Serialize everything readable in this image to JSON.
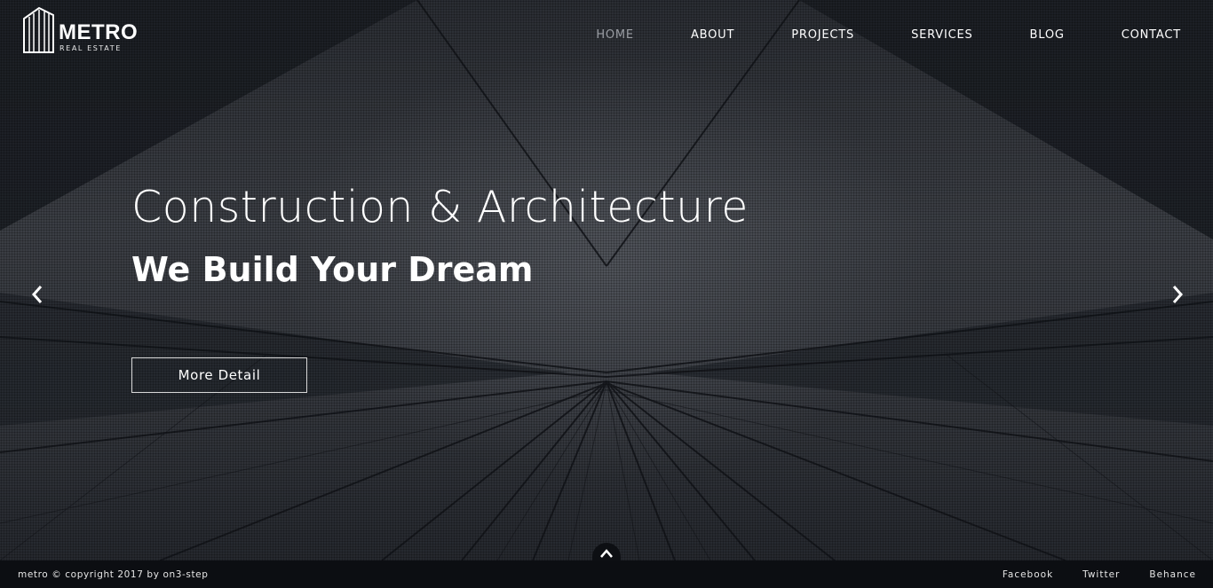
{
  "brand": {
    "name": "METRO",
    "tagline": "REAL ESTATE",
    "logo_icon": "building-icon"
  },
  "nav": {
    "items": [
      {
        "label": "HOME",
        "active": true
      },
      {
        "label": "ABOUT",
        "active": false
      },
      {
        "label": "PROJECTS",
        "active": false
      },
      {
        "label": "SERVICES",
        "active": false
      },
      {
        "label": "BLOG",
        "active": false
      },
      {
        "label": "CONTACT",
        "active": false
      }
    ]
  },
  "hero": {
    "title": "Construction & Architecture",
    "subtitle": "We Build Your Dream",
    "cta_label": "More Detail",
    "prev_icon": "chevron-left-icon",
    "next_icon": "chevron-right-icon",
    "scroll_icon": "chevron-up-icon"
  },
  "footer": {
    "copyright": "metro © copyright 2017 by on3-step",
    "social": [
      "Facebook",
      "Twitter",
      "Behance"
    ]
  },
  "colors": {
    "nav_active": "#9a9da3",
    "text": "#ffffff",
    "footer_bg": "#0c0e12"
  }
}
